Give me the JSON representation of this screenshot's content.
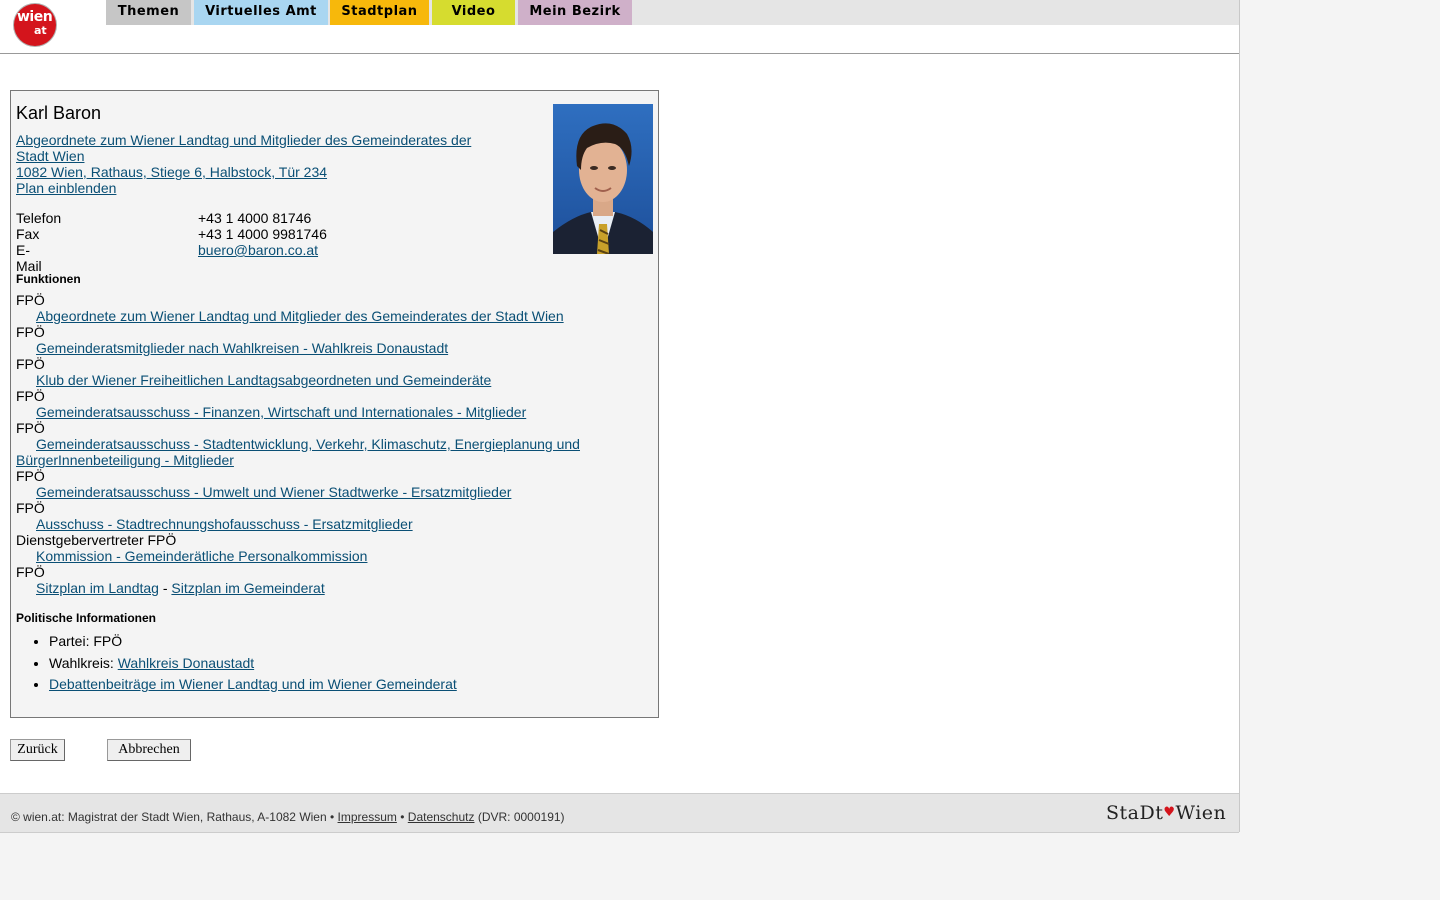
{
  "logo": {
    "text_top": "wien",
    "text_bottom": "at"
  },
  "nav": {
    "tabs": [
      {
        "label": "Themen",
        "color": "#c6c6c6"
      },
      {
        "label": "Virtuelles Amt",
        "color": "#a9d6f1"
      },
      {
        "label": "Stadtplan",
        "color": "#f7b80b"
      },
      {
        "label": "Video",
        "color": "#d6dc2f"
      },
      {
        "label": "Mein Bezirk",
        "color": "#cfb0c9"
      }
    ]
  },
  "person": {
    "name": "Karl Baron",
    "affiliation_line1": "Abgeordnete zum Wiener Landtag und Mitglieder des Gemeinderates der",
    "affiliation_line2": "Stadt Wien",
    "address": "1082 Wien, Rathaus, Stiege 6, Halbstock, Tür 234",
    "map_link": "Plan einblenden",
    "contact": [
      {
        "label": "Telefon",
        "value": "+43 1 4000 81746"
      },
      {
        "label": "Fax",
        "value": "+43 1 4000 9981746"
      },
      {
        "label": "E-Mail",
        "value": "buero@baron.co.at"
      }
    ]
  },
  "functions": {
    "heading": "Funktionen",
    "items": [
      {
        "party": "FPÖ",
        "link": "Abgeordnete zum Wiener Landtag und Mitglieder des Gemeinderates der Stadt Wien"
      },
      {
        "party": "FPÖ",
        "link": "Gemeinderatsmitglieder nach Wahlkreisen - Wahlkreis Donaustadt"
      },
      {
        "party": "FPÖ",
        "link": "Klub der Wiener Freiheitlichen Landtagsabgeordneten und Gemeinderäte"
      },
      {
        "party": "FPÖ",
        "link": "Gemeinderatsausschuss - Finanzen, Wirtschaft und Internationales - Mitglieder"
      },
      {
        "party": "FPÖ",
        "link": "Gemeinderatsausschuss - Stadtentwicklung, Verkehr, Klimaschutz, Energieplanung und BürgerInnenbeteiligung - Mitglieder"
      },
      {
        "party": "FPÖ",
        "link": "Gemeinderatsausschuss - Umwelt und Wiener Stadtwerke - Ersatzmitglieder"
      },
      {
        "party": "FPÖ",
        "link": "Ausschuss - Stadtrechnungshofausschuss - Ersatzmitglieder"
      },
      {
        "party": "Dienstgebervertreter FPÖ",
        "link": "Kommission - Gemeinderätliche Personalkommission"
      }
    ],
    "seat_party": "FPÖ",
    "seat_landtag": "Sitzplan im Landtag",
    "seat_separator": "-",
    "seat_gemeinderat": "Sitzplan im Gemeinderat"
  },
  "political": {
    "heading": "Politische Informationen",
    "partei_label": "Partei: FPÖ",
    "wahlkreis_label": "Wahlkreis:",
    "wahlkreis_link": "Wahlkreis Donaustadt",
    "debates_link": "Debattenbeiträge im Wiener Landtag und im Wiener Gemeinderat"
  },
  "buttons": {
    "back": "Zurück",
    "cancel": "Abbrechen"
  },
  "footer": {
    "copyright": "© wien.at: Magistrat der Stadt Wien, Rathaus, A-1082 Wien •",
    "impressum": "Impressum",
    "bullet": "•",
    "datenschutz": "Datenschutz",
    "dvr": "(DVR: 0000191)",
    "brand_left": "StaDt",
    "brand_heart": "♥",
    "brand_right": "Wien"
  }
}
